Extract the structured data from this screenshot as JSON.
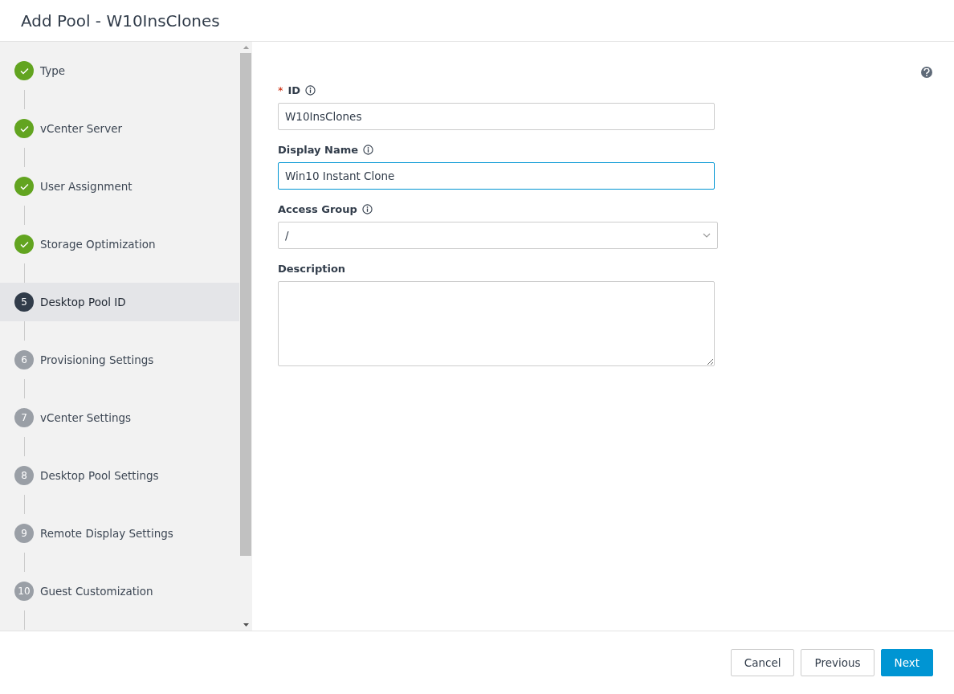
{
  "window": {
    "title": "Add Pool - W10InsClones"
  },
  "steps": [
    {
      "label": "Type",
      "completed": true,
      "selected": false
    },
    {
      "label": "vCenter Server",
      "completed": true,
      "selected": false
    },
    {
      "label": "User Assignment",
      "completed": true,
      "selected": false
    },
    {
      "label": "Storage Optimization",
      "completed": true,
      "selected": false
    },
    {
      "number": "5",
      "label": "Desktop Pool ID",
      "completed": false,
      "selected": true
    },
    {
      "number": "6",
      "label": "Provisioning Settings",
      "completed": false,
      "selected": false
    },
    {
      "number": "7",
      "label": "vCenter Settings",
      "completed": false,
      "selected": false
    },
    {
      "number": "8",
      "label": "Desktop Pool Settings",
      "completed": false,
      "selected": false
    },
    {
      "number": "9",
      "label": "Remote Display Settings",
      "completed": false,
      "selected": false
    },
    {
      "number": "10",
      "label": "Guest Customization",
      "completed": false,
      "selected": false
    }
  ],
  "form": {
    "fields": [
      {
        "kind": "text",
        "label": "ID",
        "required_mark": "*",
        "info": true,
        "value": "W10InsClones",
        "focused": false
      },
      {
        "kind": "text",
        "label": "Display Name",
        "info": true,
        "value": "Win10 Instant Clone",
        "focused": true
      },
      {
        "kind": "select",
        "label": "Access Group",
        "info": true,
        "value": "/",
        "focused": false
      },
      {
        "kind": "textarea",
        "label": "Description",
        "info": false,
        "focused": false
      }
    ]
  },
  "buttons": [
    {
      "label": "Cancel",
      "primary": false
    },
    {
      "label": "Previous",
      "primary": false
    },
    {
      "label": "Next",
      "primary": true
    }
  ]
}
